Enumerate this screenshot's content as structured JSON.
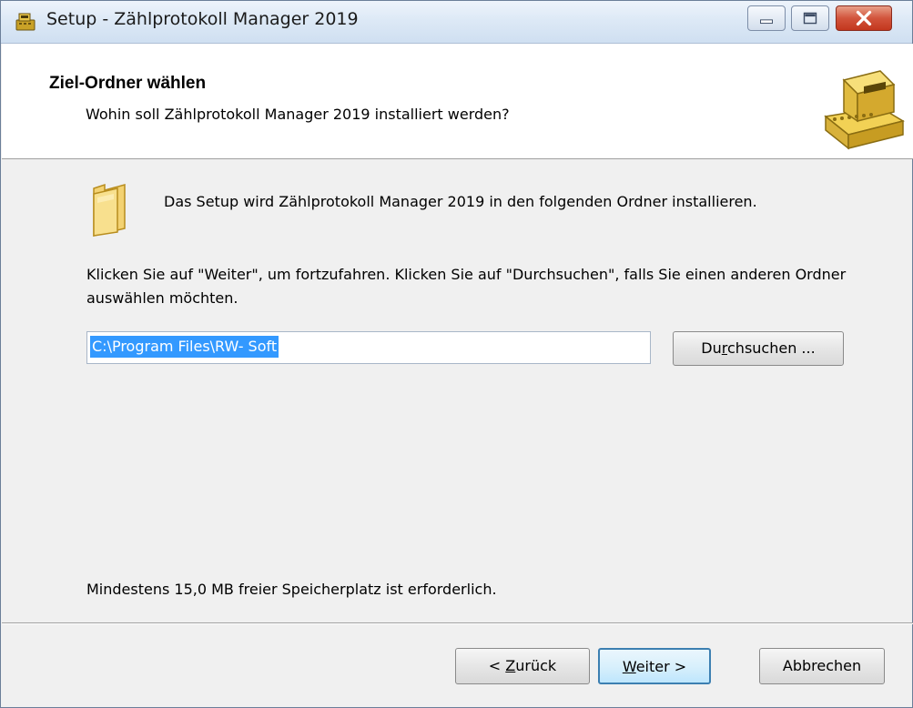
{
  "window": {
    "title": "Setup - Zählprotokoll Manager 2019",
    "controls": {
      "minimize": "minimize-icon",
      "maximize": "maximize-icon",
      "close": "close-icon"
    }
  },
  "header": {
    "title": "Ziel-Ordner wählen",
    "subtitle": "Wohin soll Zählprotokoll Manager 2019 installiert werden?",
    "icon": "cash-register-icon"
  },
  "main": {
    "folder_icon": "folder-icon",
    "intro_text": "Das Setup wird Zählprotokoll Manager 2019 in den folgenden Ordner installieren.",
    "instructions": "Klicken Sie auf \"Weiter\", um fortzufahren. Klicken Sie auf \"Durchsuchen\", falls Sie einen anderen Ordner auswählen möchten.",
    "path_value": "C:\\Program Files\\RW- Soft",
    "browse_label_pre": "Du",
    "browse_label_ul": "r",
    "browse_label_post": "chsuchen ...",
    "space_note": "Mindestens 15,0 MB freier Speicherplatz ist erforderlich."
  },
  "buttons": {
    "back_pre": "< ",
    "back_ul": "Z",
    "back_post": "urück",
    "next_ul": "W",
    "next_post": "eiter >",
    "cancel": "Abbrechen"
  },
  "colors": {
    "selection": "#3399ff",
    "default_button_border": "#3c7fb1",
    "close_button": "#c3371e"
  }
}
